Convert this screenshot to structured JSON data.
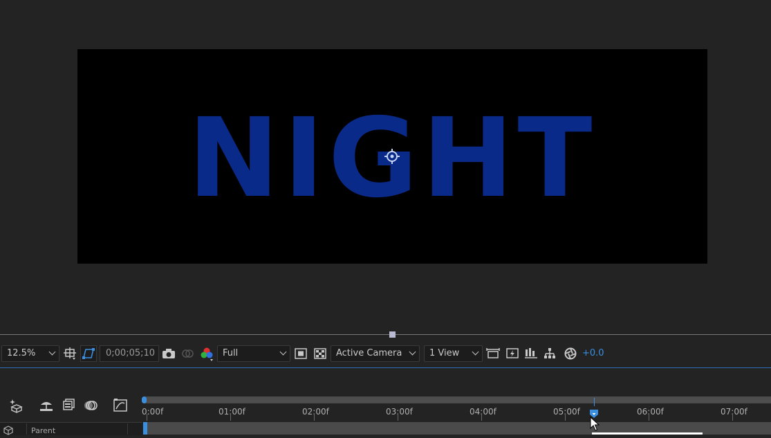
{
  "composition": {
    "text": "NIGHT",
    "text_color": "#0a2a8a"
  },
  "toolbar": {
    "magnification": "12.5%",
    "timecode": "0;00;05;10",
    "resolution": "Full",
    "camera": "Active Camera",
    "view_layout": "1 View",
    "exposure": "+0.0"
  },
  "timeline": {
    "ruler_labels": [
      "0:00f",
      "01:00f",
      "02:00f",
      "03:00f",
      "04:00f",
      "05:00f",
      "06:00f",
      "07:00f"
    ],
    "parent_header": "Parent"
  },
  "colors": {
    "accent": "#3a8fe0",
    "panel_bg": "#232323"
  }
}
